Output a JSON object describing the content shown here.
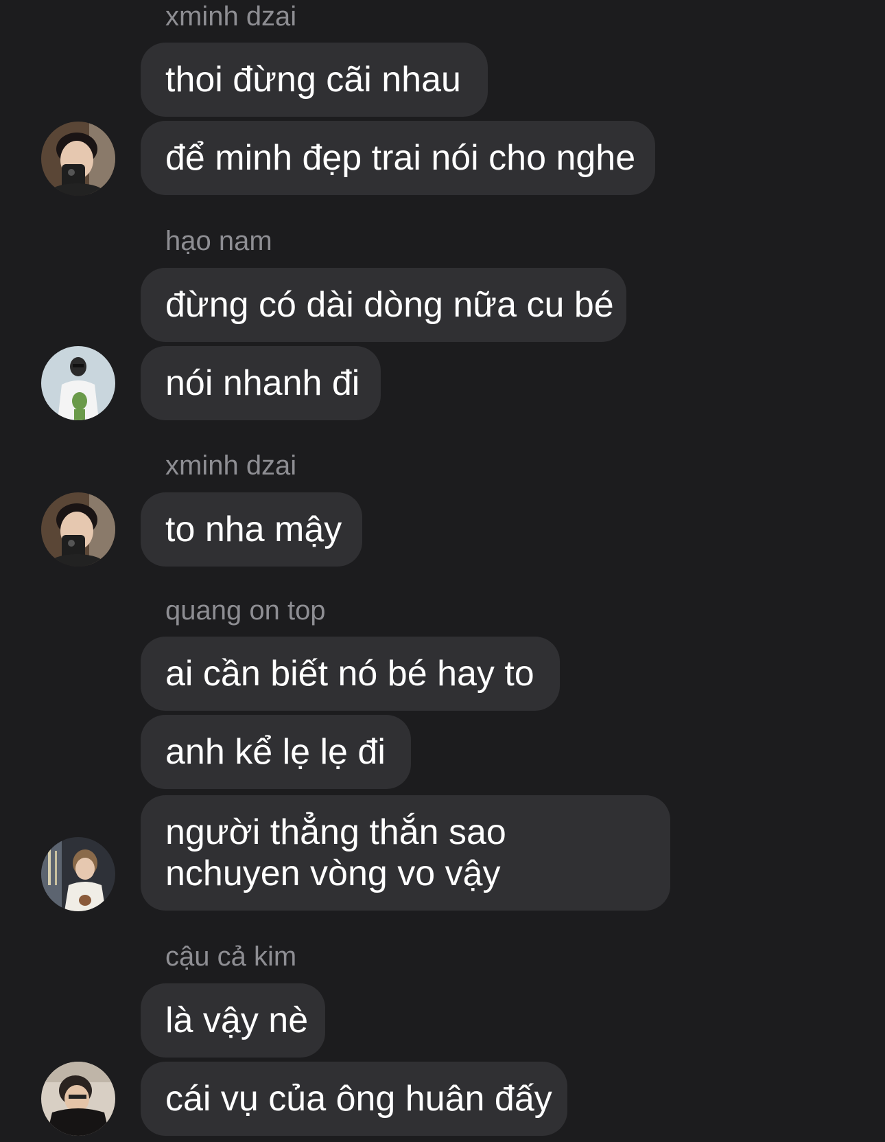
{
  "messages": [
    {
      "sender": "xminh dzai",
      "bubbles": [
        "thoi đừng cãi nhau",
        "để minh đẹp trai nói cho nghe"
      ],
      "avatar": "xminh-avatar"
    },
    {
      "sender": "hạo nam",
      "bubbles": [
        "đừng có dài dòng nữa cu bé",
        "nói nhanh đi"
      ],
      "avatar": "hao-nam-avatar"
    },
    {
      "sender": "xminh dzai",
      "bubbles": [
        "to nha mậy"
      ],
      "avatar": "xminh-avatar"
    },
    {
      "sender": "quang on top",
      "bubbles": [
        "ai cần biết nó bé hay to",
        "anh kể lẹ lẹ đi",
        "người thẳng thắn sao nchuyen vòng vo vậy"
      ],
      "avatar": "quang-avatar"
    },
    {
      "sender": "cậu cả kim",
      "bubbles": [
        "là vậy nè",
        "cái vụ của ông huân đấy"
      ],
      "avatar": "kim-avatar"
    }
  ],
  "colors": {
    "background": "#1c1c1e",
    "bubble": "#303033",
    "sender_name": "#8e8e93",
    "message_text": "#ffffff"
  }
}
